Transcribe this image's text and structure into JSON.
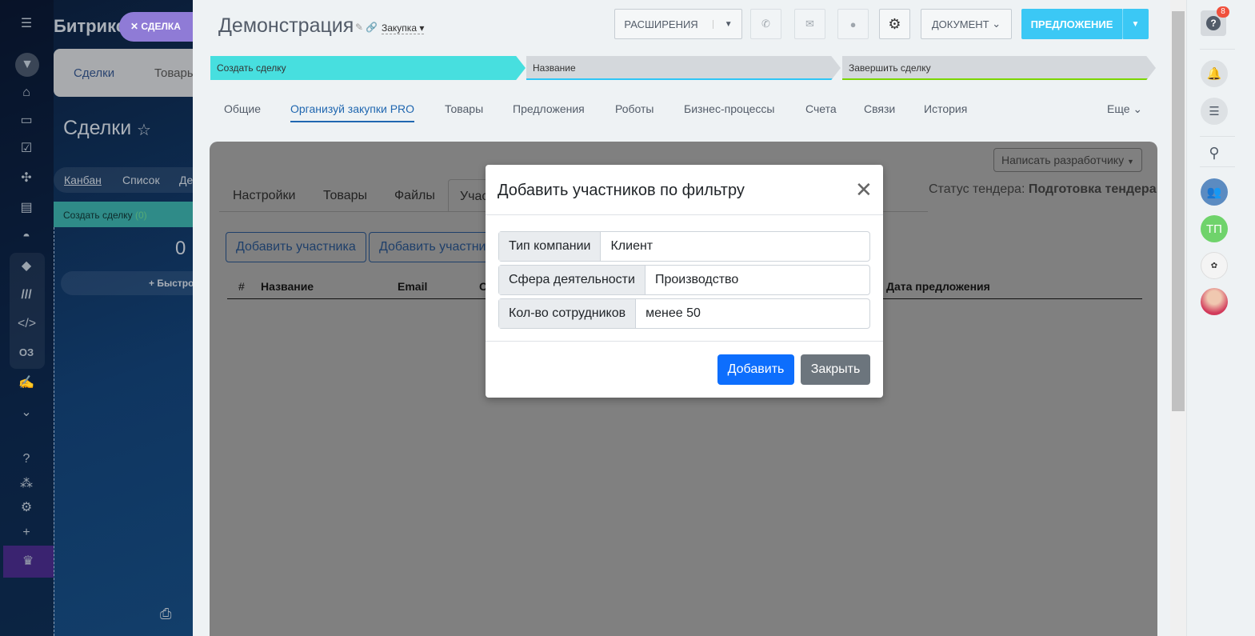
{
  "left": {
    "logo": "Битрикс",
    "close_chip": "СДЕЛКА",
    "tabs": [
      "Сделки",
      "Товары"
    ],
    "page_title": "Сделки",
    "views": [
      "Канбан",
      "Список",
      "Де"
    ],
    "column": {
      "name": "Создать сделку",
      "count": "(0)",
      "total": "0",
      "quick_add": "Быстро"
    },
    "nav_icons": [
      "menu-icon",
      "filter-icon",
      "house-icon",
      "window-icon",
      "task-icon",
      "crm-icon",
      "contact-card-icon",
      "robot-icon",
      "box-icon",
      "marketing-icon",
      "code-icon",
      "o3-icon",
      "sign-icon",
      "more-icon",
      "help-icon",
      "network-icon",
      "settings-icon",
      "plus-icon",
      "crown-icon",
      "print-icon"
    ],
    "o3_label": "ОЗ"
  },
  "header": {
    "title": "Демонстрация",
    "category": "Закупка",
    "extensions": "РАСШИРЕНИЯ",
    "document": "ДОКУМЕНТ",
    "offer": "ПРЕДЛОЖЕНИЕ"
  },
  "stages": [
    {
      "label": "Создать сделку",
      "color": "#47dfdf"
    },
    {
      "label": "Название",
      "color": "#d4d8dc"
    },
    {
      "label": "Завершить сделку",
      "color": "#d4d8dc"
    }
  ],
  "tabs": [
    "Общие",
    "Организуй закупки PRO",
    "Товары",
    "Предложения",
    "Роботы",
    "Бизнес-процессы",
    "Счета",
    "Связи",
    "История"
  ],
  "tabs_more": "Еще",
  "content": {
    "dev_button": "Написать разработчику",
    "status_label": "Статус тендера:",
    "status_value": "Подготовка тендера",
    "subtabs": [
      "Настройки",
      "Товары",
      "Файлы",
      "Учас"
    ],
    "add_participant": "Добавить участника",
    "add_participants_filter": "Добавить участни",
    "columns": [
      "#",
      "Название",
      "Email",
      "С",
      "Дата предложения"
    ]
  },
  "modal": {
    "title": "Добавить участников по фильтру",
    "fields": [
      {
        "label": "Тип компании",
        "value": "Клиент"
      },
      {
        "label": "Сфера деятельности",
        "value": "Производство"
      },
      {
        "label": "Кол-во сотрудников",
        "value": "менее 50"
      }
    ],
    "add": "Добавить",
    "close": "Закрыть"
  },
  "rail": {
    "help_badge": "8",
    "user_initials": "ТП"
  }
}
